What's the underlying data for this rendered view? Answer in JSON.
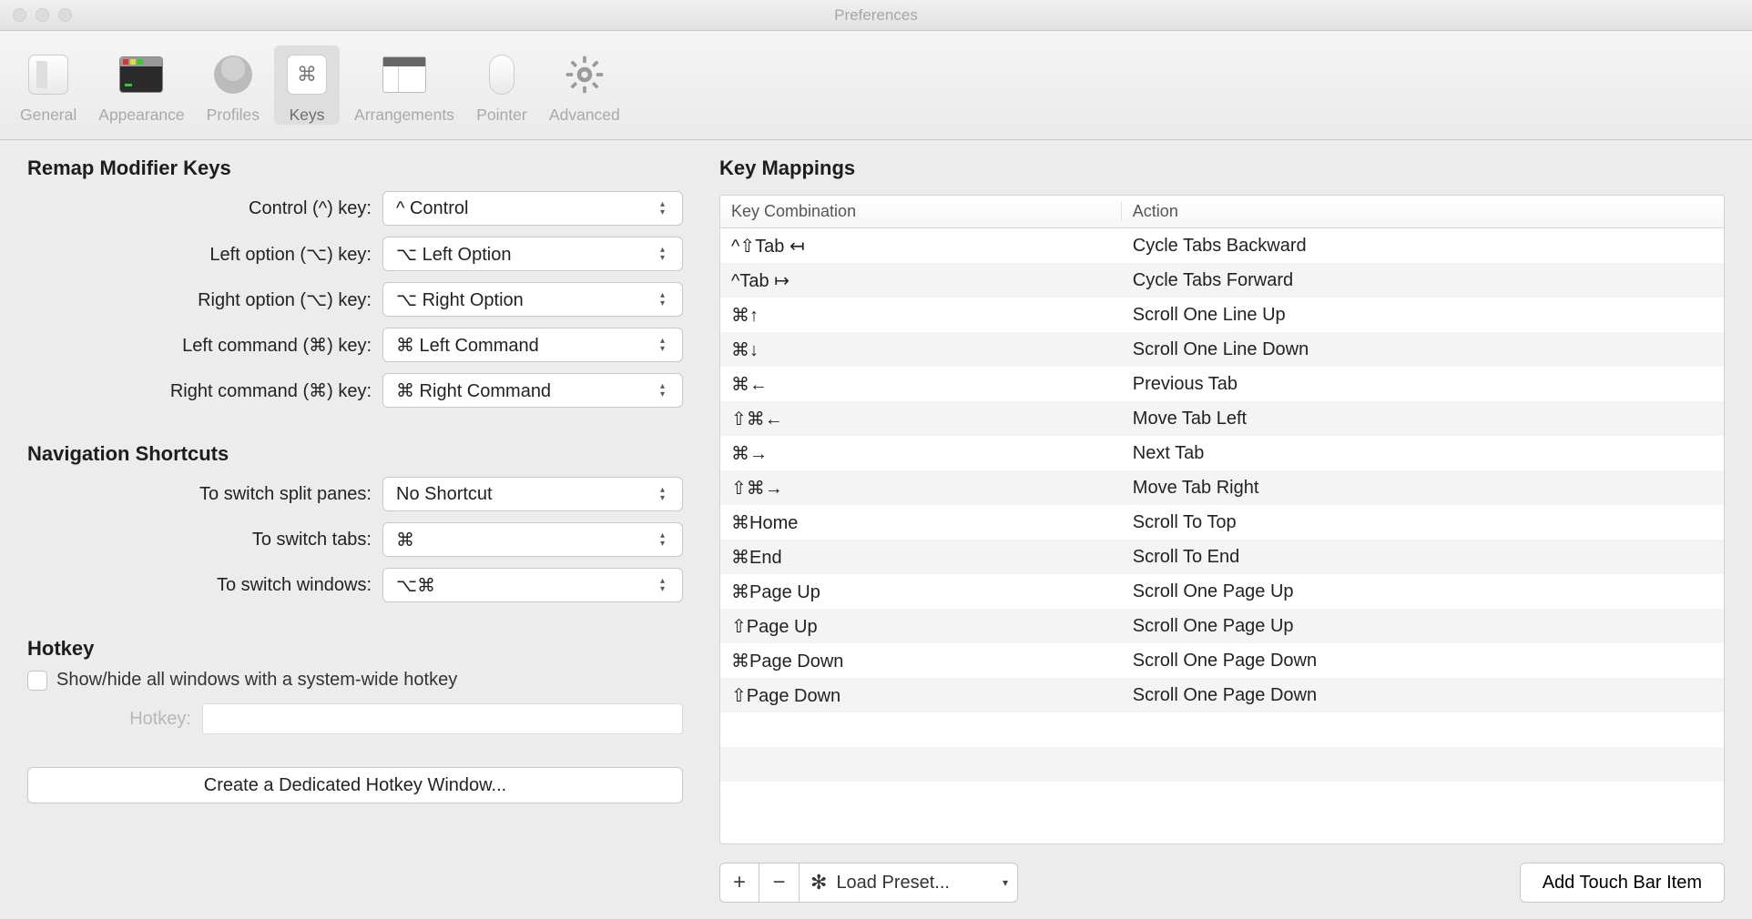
{
  "window": {
    "title": "Preferences"
  },
  "toolbar": [
    {
      "id": "general",
      "label": "General"
    },
    {
      "id": "appearance",
      "label": "Appearance"
    },
    {
      "id": "profiles",
      "label": "Profiles"
    },
    {
      "id": "keys",
      "label": "Keys",
      "active": true
    },
    {
      "id": "arrangements",
      "label": "Arrangements"
    },
    {
      "id": "pointer",
      "label": "Pointer"
    },
    {
      "id": "advanced",
      "label": "Advanced"
    }
  ],
  "left": {
    "remap": {
      "heading": "Remap Modifier Keys",
      "rows": [
        {
          "label": "Control (^) key:",
          "value": "^ Control"
        },
        {
          "label": "Left option (⌥) key:",
          "value": "⌥ Left Option"
        },
        {
          "label": "Right option (⌥) key:",
          "value": "⌥ Right Option"
        },
        {
          "label": "Left command (⌘) key:",
          "value": "⌘ Left Command"
        },
        {
          "label": "Right command (⌘) key:",
          "value": "⌘ Right Command"
        }
      ]
    },
    "nav": {
      "heading": "Navigation Shortcuts",
      "rows": [
        {
          "label": "To switch split panes:",
          "value": "No Shortcut"
        },
        {
          "label": "To switch tabs:",
          "value": "⌘"
        },
        {
          "label": "To switch windows:",
          "value": "⌥⌘"
        }
      ]
    },
    "hotkey": {
      "heading": "Hotkey",
      "checkbox_label": "Show/hide all windows with a system-wide hotkey",
      "field_label": "Hotkey:",
      "button": "Create a Dedicated Hotkey Window..."
    }
  },
  "right": {
    "heading": "Key Mappings",
    "columns": {
      "key": "Key Combination",
      "action": "Action"
    },
    "rows": [
      {
        "key": "^⇧Tab ↤",
        "action": "Cycle Tabs Backward"
      },
      {
        "key": "^Tab ↦",
        "action": "Cycle Tabs Forward"
      },
      {
        "key": "⌘↑",
        "action": "Scroll One Line Up"
      },
      {
        "key": "⌘↓",
        "action": "Scroll One Line Down"
      },
      {
        "key": "⌘←",
        "action": "Previous Tab"
      },
      {
        "key": "⇧⌘←",
        "action": "Move Tab Left"
      },
      {
        "key": "⌘→",
        "action": "Next Tab"
      },
      {
        "key": "⇧⌘→",
        "action": "Move Tab Right"
      },
      {
        "key": "⌘Home",
        "action": "Scroll To Top"
      },
      {
        "key": "⌘End",
        "action": "Scroll To End"
      },
      {
        "key": "⌘Page Up",
        "action": "Scroll One Page Up"
      },
      {
        "key": "⇧Page Up",
        "action": "Scroll One Page Up"
      },
      {
        "key": "⌘Page Down",
        "action": "Scroll One Page Down"
      },
      {
        "key": "⇧Page Down",
        "action": "Scroll One Page Down"
      },
      {
        "key": "",
        "action": ""
      },
      {
        "key": "",
        "action": ""
      },
      {
        "key": "",
        "action": ""
      }
    ],
    "buttons": {
      "add": "+",
      "remove": "−",
      "preset": "Load Preset...",
      "touch": "Add Touch Bar Item"
    }
  }
}
